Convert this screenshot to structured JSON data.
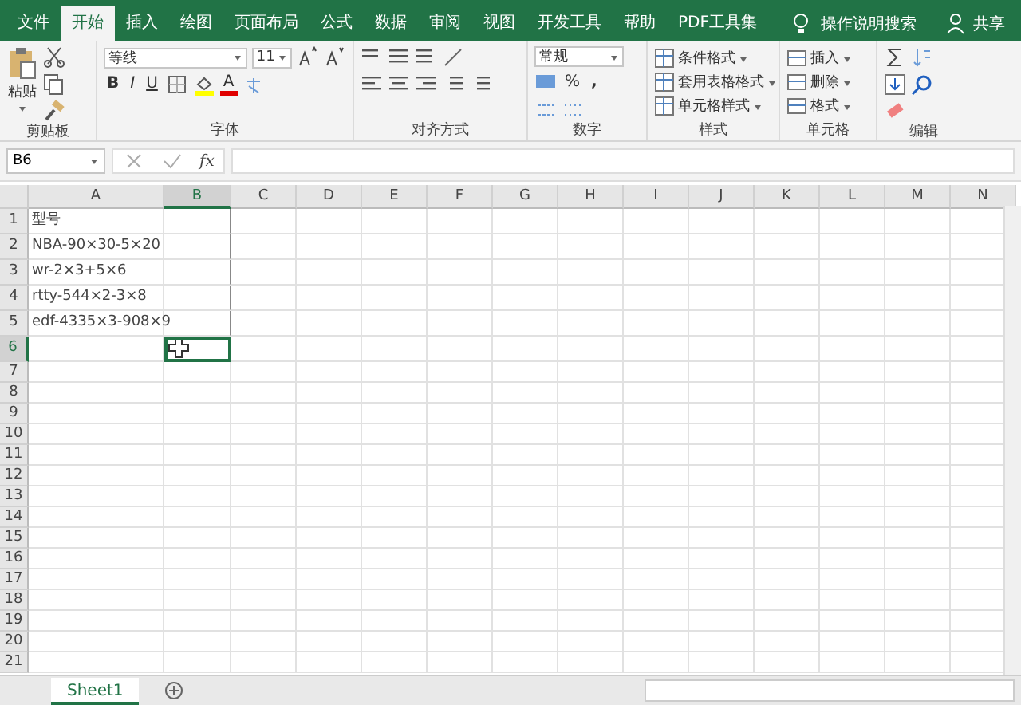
{
  "tabs": [
    {
      "label": "文件",
      "selected": false
    },
    {
      "label": "开始",
      "selected": true
    },
    {
      "label": "插入",
      "selected": false
    },
    {
      "label": "绘图",
      "selected": false
    },
    {
      "label": "页面布局",
      "selected": false
    },
    {
      "label": "公式",
      "selected": false
    },
    {
      "label": "数据",
      "selected": false
    },
    {
      "label": "审阅",
      "selected": false
    },
    {
      "label": "视图",
      "selected": false
    },
    {
      "label": "开发工具",
      "selected": false
    },
    {
      "label": "帮助",
      "selected": false
    },
    {
      "label": "PDF工具集",
      "selected": false
    }
  ],
  "tell_me": "操作说明搜索",
  "share": "共享",
  "ribbon": {
    "clipboard": {
      "label": "剪贴板",
      "paste": "粘贴"
    },
    "font": {
      "label": "字体",
      "font_name": "等线",
      "font_size": "11",
      "bold": "B",
      "italic": "I",
      "underline": "U",
      "font_color": "A"
    },
    "alignment": {
      "label": "对齐方式"
    },
    "number": {
      "label": "数字",
      "format": "常规",
      "percent": "%",
      "comma": ","
    },
    "styles": {
      "label": "样式",
      "items": [
        "条件格式",
        "套用表格格式",
        "单元格样式"
      ]
    },
    "cells": {
      "label": "单元格",
      "items": [
        "插入",
        "删除",
        "格式"
      ]
    },
    "editing": {
      "label": "编辑"
    }
  },
  "formula_bar": {
    "name_box": "B6",
    "function": "fx"
  },
  "sheet": {
    "columns": [
      {
        "label": "A",
        "selected": false
      },
      {
        "label": "B",
        "selected": true
      },
      {
        "label": "C",
        "selected": false
      },
      {
        "label": "D",
        "selected": false
      },
      {
        "label": "E",
        "selected": false
      },
      {
        "label": "F",
        "selected": false
      },
      {
        "label": "G",
        "selected": false
      },
      {
        "label": "H",
        "selected": false
      },
      {
        "label": "I",
        "selected": false
      },
      {
        "label": "J",
        "selected": false
      },
      {
        "label": "K",
        "selected": false
      },
      {
        "label": "L",
        "selected": false
      },
      {
        "label": "M",
        "selected": false
      },
      {
        "label": "N",
        "selected": false
      }
    ],
    "rows": [
      {
        "number": "1",
        "selected": false,
        "a": "型号"
      },
      {
        "number": "2",
        "selected": false,
        "a": "NBA-90×30-5×20"
      },
      {
        "number": "3",
        "selected": false,
        "a": "wr-2×3+5×6"
      },
      {
        "number": "4",
        "selected": false,
        "a": "rtty-544×2-3×8"
      },
      {
        "number": "5",
        "selected": false,
        "a": "edf-4335×3-908×9"
      },
      {
        "number": "6",
        "selected": true
      },
      {
        "number": "7",
        "selected": false
      },
      {
        "number": "8",
        "selected": false
      },
      {
        "number": "9",
        "selected": false
      },
      {
        "number": "10",
        "selected": false
      },
      {
        "number": "11",
        "selected": false
      },
      {
        "number": "12",
        "selected": false
      },
      {
        "number": "13",
        "selected": false
      },
      {
        "number": "14",
        "selected": false
      },
      {
        "number": "15",
        "selected": false
      },
      {
        "number": "16",
        "selected": false
      },
      {
        "number": "17",
        "selected": false
      },
      {
        "number": "18",
        "selected": false
      },
      {
        "number": "19",
        "selected": false
      },
      {
        "number": "20",
        "selected": false
      },
      {
        "number": "21",
        "selected": false
      }
    ]
  },
  "sheet_tabs": [
    {
      "label": "Sheet1",
      "selected": true
    }
  ]
}
